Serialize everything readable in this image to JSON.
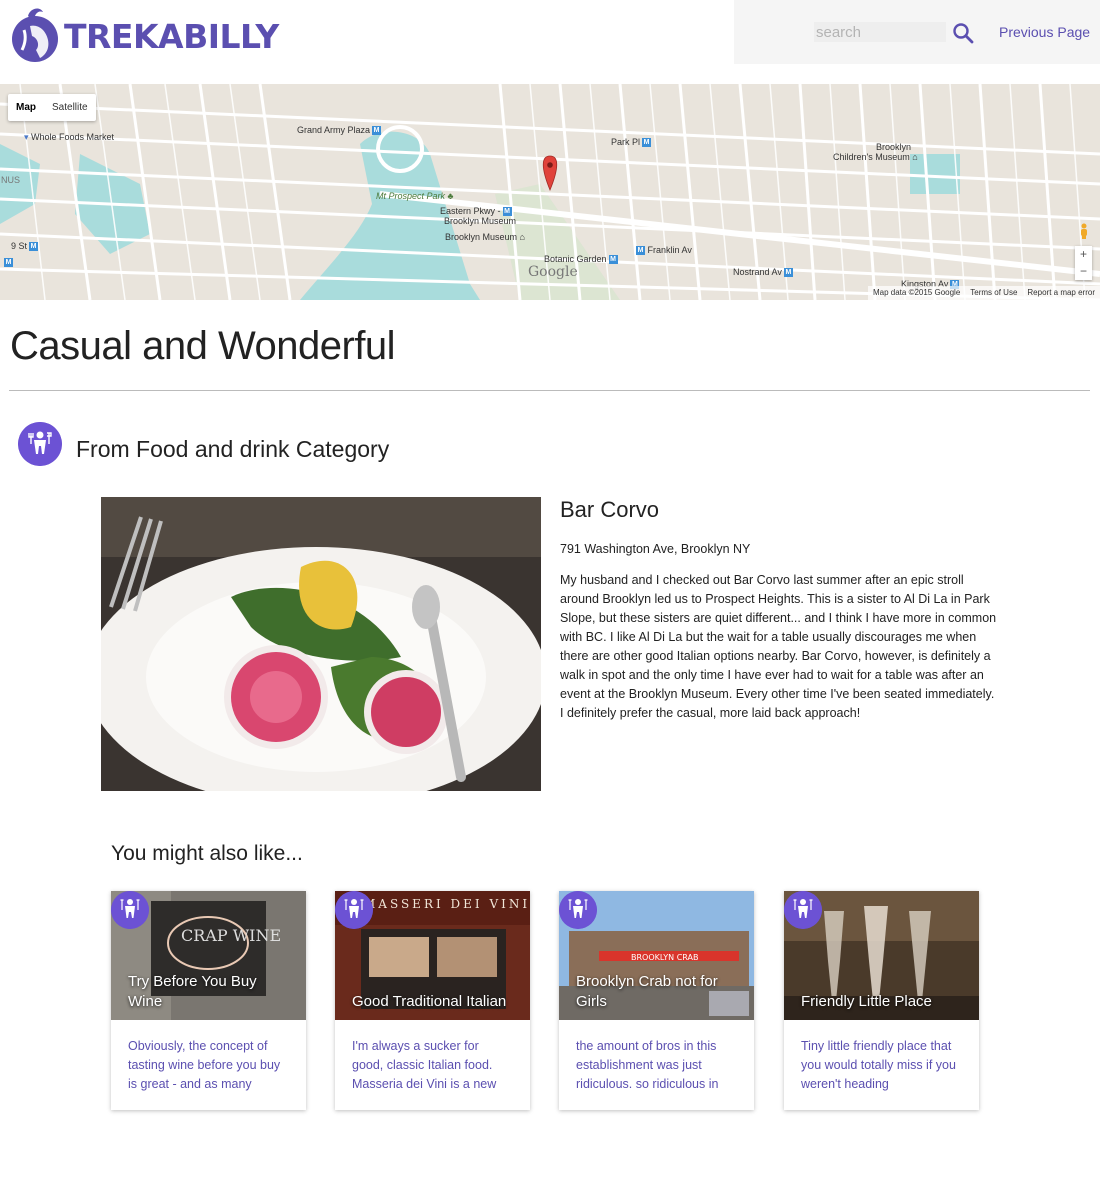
{
  "header": {
    "logo_text": "TREKABILLY",
    "search_placeholder": "search",
    "previous_page_label": "Previous Page"
  },
  "colors": {
    "brand": "#5b4fb0",
    "category_badge": "#6c52d4"
  },
  "map": {
    "type_options": [
      "Map",
      "Satellite"
    ],
    "selected_type": "Map",
    "labels": {
      "whole_foods": "Whole Foods Market",
      "grand_army": "Grand Army Plaza",
      "park_pl": "Park Pl",
      "childrens_museum_1": "Brooklyn",
      "childrens_museum_2": "Children's Museum",
      "nus": "NUS",
      "mt_prospect": "Mt Prospect Park",
      "eastern_pkwy_1": "Eastern Pkwy -",
      "eastern_pkwy_2": "Brooklyn Museum",
      "brooklyn_museum": "Brooklyn Museum",
      "nine_st": "9 St",
      "franklin_av": "Franklin Av",
      "botanic_garden": "Botanic Garden",
      "nostrand_av": "Nostrand Av",
      "kingston_av": "Kingston Av",
      "google": "Google"
    },
    "zoom_in": "+",
    "zoom_out": "−",
    "footer": [
      "Map data ©2015 Google",
      "Terms of Use",
      "Report a map error"
    ]
  },
  "page_title": "Casual and Wonderful",
  "category": {
    "icon": "waiter-icon",
    "text": "From Food and drink Category"
  },
  "feature": {
    "name": "Bar Corvo",
    "address": "791 Washington Ave, Brooklyn NY",
    "description": "My husband and I checked out Bar Corvo last summer after an epic stroll around Brooklyn led us to Prospect Heights. This is a sister to Al Di La in Park Slope, but these sisters are quiet different... and I think I have more in common with BC. I like Al Di La but the wait for a table usually discourages me when there are other good Italian options nearby. Bar Corvo, however, is definitely a walk in spot and the only time I have ever had to wait for a table was after an event at the Brooklyn Museum. Every other time I've been seated immediately. I definitely prefer the casual, more laid back approach!"
  },
  "also_like": {
    "title": "You might also like...",
    "cards": [
      {
        "title": "Try Before You Buy Wine",
        "excerpt": "Obviously, the concept of tasting wine before you buy is great - and as many",
        "image_sign": "CRAP WINE"
      },
      {
        "title": "Good Traditional Italian",
        "excerpt": "I'm always a sucker for good, classic Italian food. Masseria dei Vini is a new",
        "image_sign": "MASSERI DEI VINI"
      },
      {
        "title": "Brooklyn Crab not for Girls",
        "excerpt": "the amount of bros in this establishment was just ridiculous. so ridiculous in",
        "image_sign": "BROOKLYN CRAB"
      },
      {
        "title": "Friendly Little Place",
        "excerpt": "Tiny little friendly place that you would totally miss if you weren't heading",
        "image_sign": ""
      }
    ]
  }
}
